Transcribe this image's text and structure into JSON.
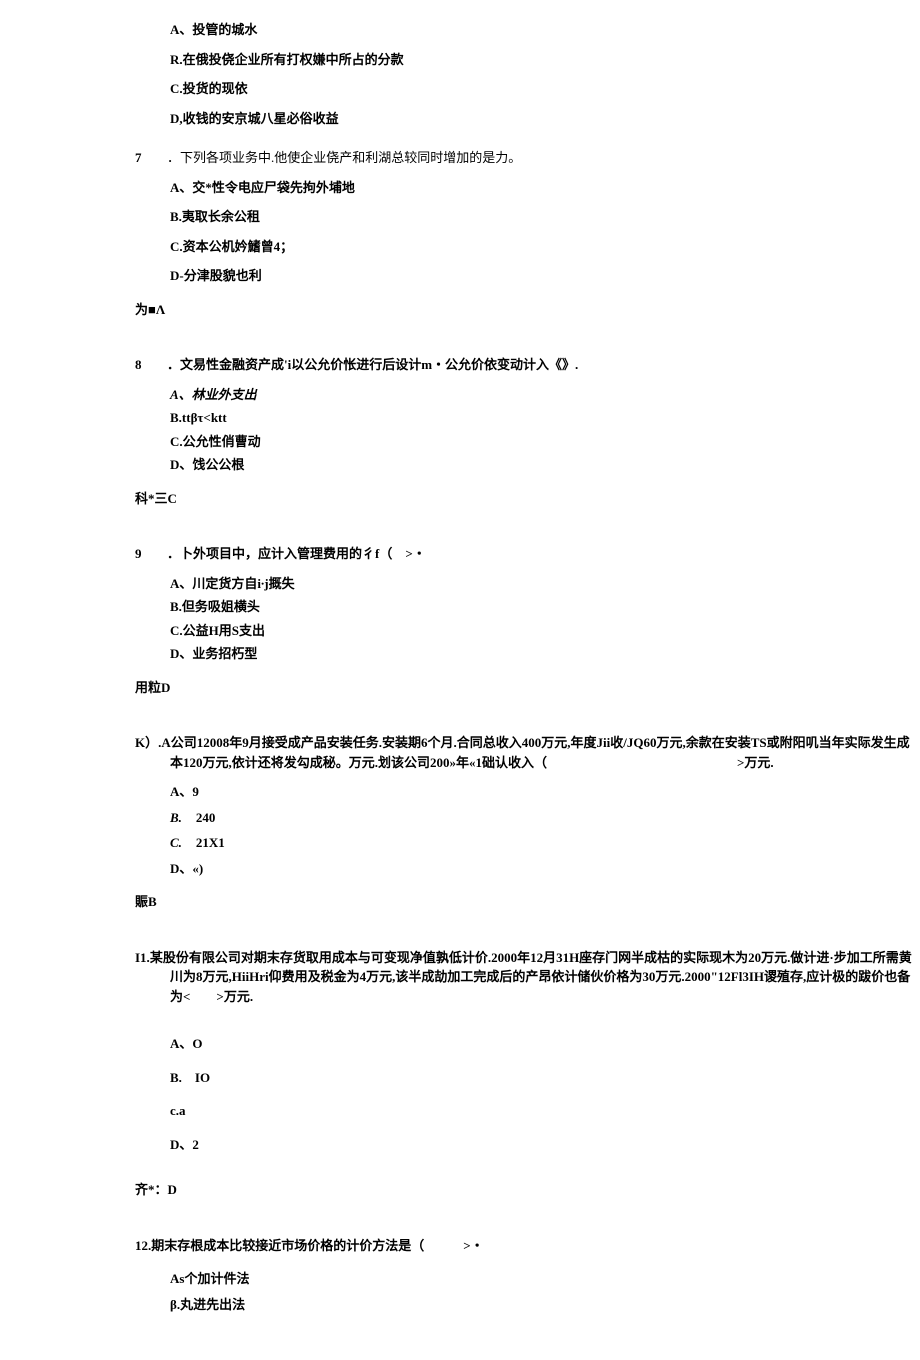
{
  "q6": {
    "optA": "A、投管的城水",
    "optR": "R.在俄投侥企业所有打权嫌中所占的分款",
    "optC": "C.投货的现依",
    "optD": "D,收钱的安京城八星必俗收益"
  },
  "q7": {
    "num": "7",
    "stem": "．下列各项业务中.他使企业侥产和利湖总较同时增加的是力。",
    "optA": "A、交*性令电应尸袋先拘外埔地",
    "optB": "B.夷取长余公租",
    "optC": "C.资本公机妗鰭曾4；",
    "optD": "D-分津股貌也利",
    "answer": "为■Λ"
  },
  "q8": {
    "num": "8",
    "stem": "．文易性金融资产成'i以公允价怅进行后设计m・公允价依变动计入《》.",
    "optA": "A、林业外支出",
    "optB": "B.ttβτ<ktt",
    "optC": "C.公允性俏曹动",
    "optD": "D、饯公公根",
    "answer": "科*三C"
  },
  "q9": {
    "num": "9",
    "stem": "．卜外项目中，应计入管理费用的彳f（　>・",
    "optA": "A、川定货方自i∙j摡失",
    "optB": "B.但务吸姐横头",
    "optC": "C.公益H用S支出",
    "optD": "D、业务招朽型",
    "answer": "用粒D"
  },
  "q10": {
    "num": "K）.",
    "stem1": "A公司12008年9月接受成产品安装任务.安装期6个月.合同总收入400万元,年度Jii收/JQ60万元,余款在安装TS或附阳叽当年实际发生成本120万元,依计还将发勾成秘。万元.划该公司200»年«1础认收入（",
    "stem2": ">万元.",
    "optA": "A、9",
    "optBLabel": "B.",
    "optBVal": "240",
    "optCLabel": "C.",
    "optCVal": "21X1",
    "optD": "D、«)",
    "answer": "賑B"
  },
  "q11": {
    "num": "I1.",
    "stem": "某股份有限公司对期末存货取用成本与可变现净值孰低计价.2000年12月31H座存门网半成枯的实际现木为20万元.做计进·步加工所需黄川为8万元,HiiHri仰费用及税金为4万元,该半成劼加工完成后的产昂依计储伙价格为30万元.2000\"12Fl3IH谡殖存,应计极的跋价也备为<　　>万元.",
    "optA": "A、O",
    "optB": "B.　IO",
    "optC": "c.a",
    "optD": "D、2",
    "answer": "齐*：D"
  },
  "q12": {
    "num": "12.",
    "stem": "期末存根成本比较接近市场价格的计价方法是（　　　>・",
    "optAs": "As个加计件法",
    "optBeta": "β.丸进先出法"
  }
}
